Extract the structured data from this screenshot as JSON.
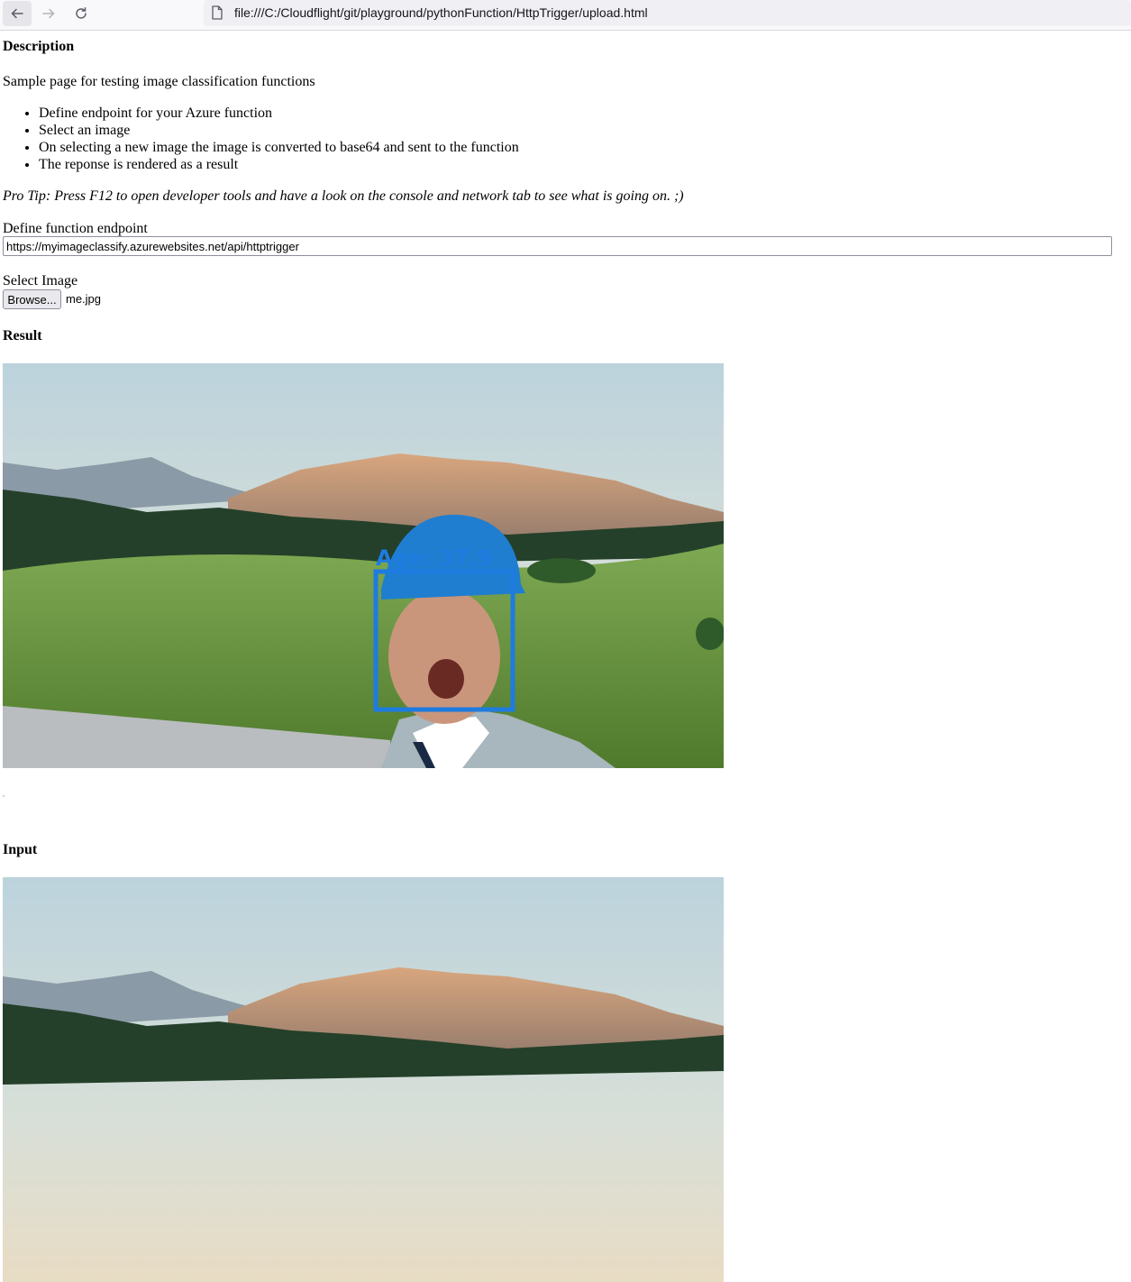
{
  "browser": {
    "url": "file:///C:/Cloudflight/git/playground/pythonFunction/HttpTrigger/upload.html"
  },
  "page": {
    "description_heading": "Description",
    "intro": "Sample page for testing image classification functions",
    "steps": [
      "Define endpoint for your Azure function",
      "Select an image",
      "On selecting a new image the image is converted to base64 and sent to the function",
      "The reponse is rendered as a result"
    ],
    "pro_tip": "Pro Tip: Press F12 to open developer tools and have a look on the console and network tab to see what is going on. ;)",
    "endpoint_label": "Define function endpoint",
    "endpoint_value": "https://myimageclassify.azurewebsites.net/api/httptrigger",
    "select_image_label": "Select Image",
    "browse_button": "Browse...",
    "selected_file": "me.jpg",
    "result_heading": "Result",
    "age_annotation": "Age: 37.9",
    "input_heading": "Input"
  },
  "colors": {
    "annotation_blue": "#1e7be0"
  },
  "icons": {
    "back": "arrow-left-icon",
    "forward": "arrow-right-icon",
    "reload": "reload-icon",
    "page": "page-icon"
  }
}
